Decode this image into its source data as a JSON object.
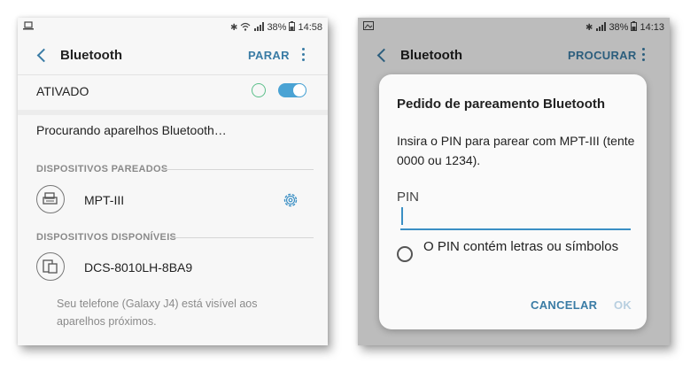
{
  "left_screen": {
    "status": {
      "time": "14:58",
      "battery": "38%",
      "icons": [
        "laptop-icon",
        "bluetooth-icon",
        "wifi-icon",
        "signal-icon",
        "battery-icon"
      ]
    },
    "appbar": {
      "title": "Bluetooth",
      "action": "PARAR"
    },
    "toggle_row": {
      "label": "ATIVADO",
      "enabled": true
    },
    "searching_text": "Procurando aparelhos Bluetooth…",
    "paired_section": {
      "header": "DISPOSITIVOS PAREADOS",
      "devices": [
        {
          "name": "MPT-III",
          "icon": "printer-icon",
          "has_settings": true
        }
      ]
    },
    "available_section": {
      "header": "DISPOSITIVOS DISPONÍVEIS",
      "devices": [
        {
          "name": "DCS-8010LH-8BA9",
          "icon": "multi-device-icon"
        }
      ]
    },
    "visibility_note": "Seu telefone (Galaxy J4) está visível aos aparelhos próximos."
  },
  "right_screen": {
    "status": {
      "time": "14:13",
      "battery": "38%",
      "icons": [
        "image-icon",
        "bluetooth-icon",
        "signal-icon",
        "battery-icon"
      ]
    },
    "appbar": {
      "title": "Bluetooth",
      "action": "PROCURAR"
    },
    "dialog": {
      "title": "Pedido de pareamento Bluetooth",
      "message": "Insira o PIN para parear com MPT-III (tente 0000 ou 1234).",
      "pin_label": "PIN",
      "pin_value": "",
      "checkbox_label": "O PIN contém letras ou símbolos",
      "cancel_label": "CANCELAR",
      "ok_label": "OK"
    }
  },
  "colors": {
    "accent": "#3a7ca5",
    "toggle_on": "#4aa3d4",
    "ring": "#5bbf8a",
    "ok_disabled": "#b8cfe0",
    "section_header": "#8a8a8a"
  }
}
